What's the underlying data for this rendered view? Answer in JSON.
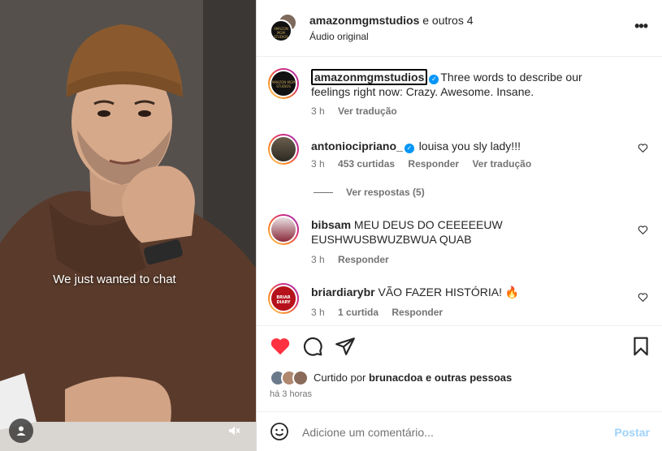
{
  "video": {
    "caption": "We just wanted to chat",
    "user_icon": "user-icon",
    "mute_icon": "speaker-muted-icon"
  },
  "header": {
    "account": "amazonmgmstudios",
    "others": "e outros 4",
    "audio": "Áudio original",
    "avatar_text": "AMAZON MGM STUDIOS",
    "more_icon": "more-horizontal-icon",
    "more_label": "•••"
  },
  "comments": [
    {
      "username": "amazonmgmstudios",
      "verified": true,
      "text": "Three words to describe our feelings right now: Crazy. Awesome. Insane.",
      "time": "3 h",
      "translate": "Ver tradução"
    },
    {
      "username": "antoniocipriano_",
      "verified": true,
      "text": "louisa you sly lady!!!",
      "time": "3 h",
      "likes": "453 curtidas",
      "reply": "Responder",
      "translate": "Ver tradução",
      "view_replies": "Ver respostas (5)"
    },
    {
      "username": "bibsam",
      "verified": false,
      "text": "MEU DEUS DO CEEEEEUW EUSHWUSBWUZBWUA QUAB",
      "time": "3 h",
      "reply": "Responder"
    },
    {
      "username": "briardiarybr",
      "verified": false,
      "text": "VÃO FAZER HISTÓRIA! 🔥",
      "time": "3 h",
      "likes": "1 curtida",
      "reply": "Responder",
      "avatar_text": "BRIAR DIARY"
    }
  ],
  "actions": {
    "like_icon": "heart-filled-icon",
    "comment_icon": "comment-icon",
    "share_icon": "send-icon",
    "save_icon": "bookmark-icon",
    "liked_by_prefix": "Curtido por",
    "liked_by_user": "brunacdoa",
    "liked_by_suffix": "e outras pessoas",
    "date": "há 3 horas"
  },
  "add_comment": {
    "placeholder": "Adicione um comentário...",
    "post_label": "Postar",
    "emoji_icon": "emoji-icon"
  },
  "colors": {
    "like_red": "#ff3040",
    "verified_blue": "#0095f6",
    "post_disabled": "#9fd3fb",
    "meta_gray": "#737373"
  }
}
